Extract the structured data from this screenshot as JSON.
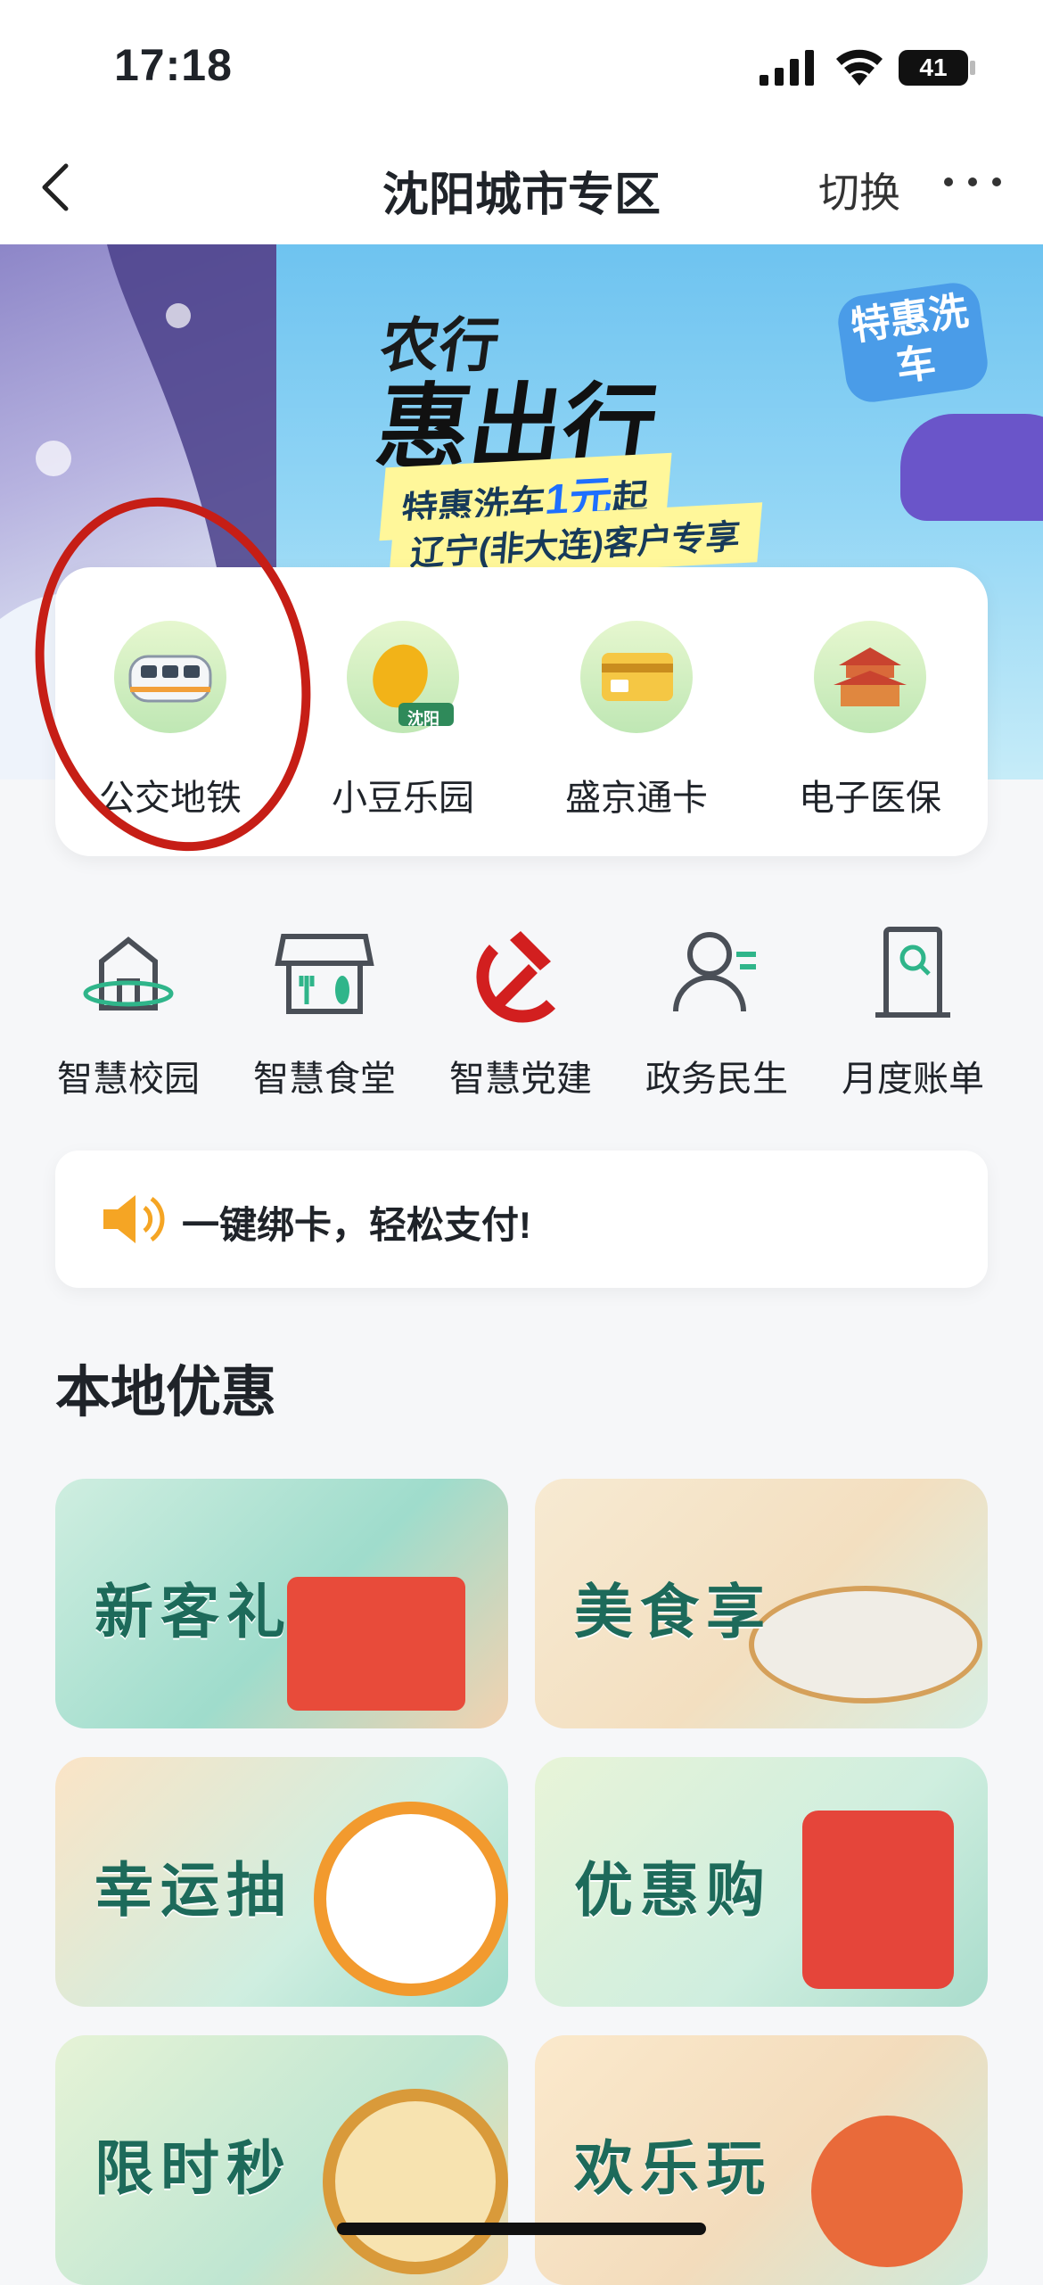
{
  "status_bar": {
    "time": "17:18",
    "battery": "41"
  },
  "nav": {
    "title": "沈阳城市专区",
    "switch_label": "切换"
  },
  "banner": {
    "title_line1": "农行",
    "title_line2": "惠出行",
    "tag1_prefix": "特惠洗车",
    "tag1_highlight": "1元",
    "tag1_suffix": "起",
    "tag2": "辽宁(非大连)客户专享",
    "bubble": "特惠洗车"
  },
  "services": [
    {
      "label": "公交地铁",
      "icon": "subway-train-icon"
    },
    {
      "label": "小豆乐园",
      "icon": "bean-icon",
      "badge": "沈阳"
    },
    {
      "label": "盛京通卡",
      "icon": "card-icon"
    },
    {
      "label": "电子医保",
      "icon": "palace-icon"
    }
  ],
  "row2": [
    {
      "label": "智慧校园",
      "icon": "campus-icon"
    },
    {
      "label": "智慧食堂",
      "icon": "canteen-icon"
    },
    {
      "label": "智慧党建",
      "icon": "party-emblem-icon"
    },
    {
      "label": "政务民生",
      "icon": "person-icon"
    },
    {
      "label": "月度账单",
      "icon": "bill-search-icon"
    }
  ],
  "notice": {
    "text": "一键绑卡，轻松支付!"
  },
  "section": {
    "title": "本地优惠"
  },
  "tiles": [
    {
      "label": "新客礼"
    },
    {
      "label": "美食享"
    },
    {
      "label": "幸运抽"
    },
    {
      "label": "优惠购"
    },
    {
      "label": "限时秒"
    },
    {
      "label": "欢乐玩"
    }
  ],
  "colors": {
    "accent": "#1d6a5a",
    "highlight_red": "#c61e16"
  }
}
